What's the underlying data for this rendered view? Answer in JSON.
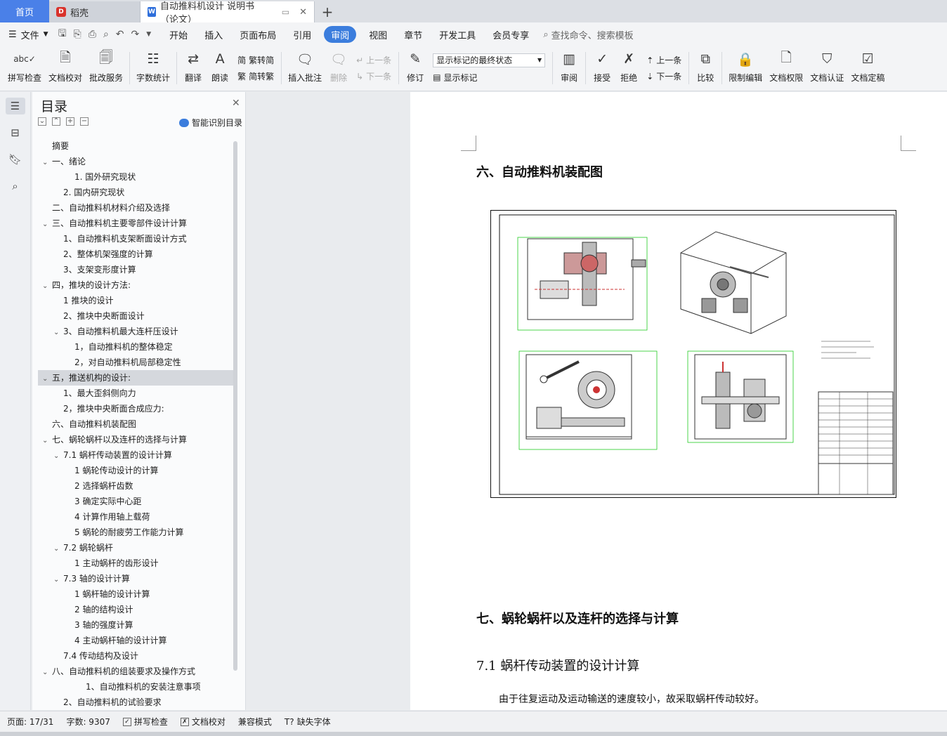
{
  "tabs": {
    "home": "首页",
    "daoke": "稻壳",
    "doc": "自动推料机设计 说明书（论文）"
  },
  "menu": {
    "file": "文件",
    "items": [
      "开始",
      "插入",
      "页面布局",
      "引用",
      "审阅",
      "视图",
      "章节",
      "开发工具",
      "会员专享"
    ],
    "active": "审阅",
    "search": "查找命令、搜索模板"
  },
  "ribbon": {
    "spell": "拼写检查",
    "proof": "文档校对",
    "batch": "批改服务",
    "wordcount": "字数统计",
    "translate": "翻译",
    "read": "朗读",
    "trad": "繁转简",
    "simp": "简转繁",
    "insert_comment": "插入批注",
    "delete": "删除",
    "prev": "上一条",
    "next": "下一条",
    "revise": "修订",
    "markup_state": "显示标记的最终状态",
    "show_markup": "显示标记",
    "review": "审阅",
    "accept": "接受",
    "reject": "拒绝",
    "prev2": "上一条",
    "next2": "下一条",
    "compare": "比较",
    "restrict": "限制编辑",
    "rights": "文档权限",
    "certify": "文档认证",
    "final": "文档定稿"
  },
  "toc": {
    "title": "目录",
    "smart": "智能识别目录",
    "items": [
      {
        "text": "摘要",
        "level": 0,
        "caret": ""
      },
      {
        "text": "一、绪论",
        "level": 0,
        "caret": "v"
      },
      {
        "text": "1. 国外研究现状",
        "level": 2,
        "caret": ""
      },
      {
        "text": "2. 国内研究现状",
        "level": 1,
        "caret": ""
      },
      {
        "text": "二、自动推料机材料介绍及选择",
        "level": 0,
        "caret": ""
      },
      {
        "text": "三、自动推料机主要零部件设计计算",
        "level": 0,
        "caret": "v"
      },
      {
        "text": "1、自动推料机支架断面设计方式",
        "level": 1,
        "caret": ""
      },
      {
        "text": "2、整体机架强度的计算",
        "level": 1,
        "caret": ""
      },
      {
        "text": "3、支架变形度计算",
        "level": 1,
        "caret": ""
      },
      {
        "text": "四，推块的设计方法:",
        "level": 0,
        "caret": "v"
      },
      {
        "text": "1 推块的设计",
        "level": 1,
        "caret": ""
      },
      {
        "text": "2、推块中央断面设计",
        "level": 1,
        "caret": ""
      },
      {
        "text": "3、自动推料机最大连杆压设计",
        "level": 1,
        "caret": "v"
      },
      {
        "text": "1，自动推料机的整体稳定",
        "level": 2,
        "caret": ""
      },
      {
        "text": "2，对自动推料机局部稳定性",
        "level": 2,
        "caret": ""
      },
      {
        "text": "五，推送机构的设计:",
        "level": 0,
        "caret": "v"
      },
      {
        "text": "1、最大歪斜侧向力",
        "level": 1,
        "caret": ""
      },
      {
        "text": "2，推块中央断面合成应力:",
        "level": 1,
        "caret": ""
      },
      {
        "text": "六、自动推料机装配图",
        "level": 0,
        "caret": ""
      },
      {
        "text": "七、蜗轮蜗杆以及连杆的选择与计算",
        "level": 0,
        "caret": "v"
      },
      {
        "text": "7.1  蜗杆传动装置的设计计算",
        "level": 1,
        "caret": "v"
      },
      {
        "text": "1 蜗轮传动设计的计算",
        "level": 2,
        "caret": ""
      },
      {
        "text": "2 选择蜗杆齿数",
        "level": 2,
        "caret": ""
      },
      {
        "text": "3 确定实际中心距",
        "level": 2,
        "caret": ""
      },
      {
        "text": "4 计算作用轴上载荷",
        "level": 2,
        "caret": ""
      },
      {
        "text": "5 蜗轮的耐疲劳工作能力计算",
        "level": 2,
        "caret": ""
      },
      {
        "text": "7.2   蜗轮蜗杆",
        "level": 1,
        "caret": "v"
      },
      {
        "text": "1 主动蜗杆的齿形设计",
        "level": 2,
        "caret": ""
      },
      {
        "text": "7.3    轴的设计计算",
        "level": 1,
        "caret": "v"
      },
      {
        "text": "1    蜗杆轴的设计计算",
        "level": 2,
        "caret": ""
      },
      {
        "text": "2 轴的结构设计",
        "level": 2,
        "caret": ""
      },
      {
        "text": "3    轴的强度计算",
        "level": 2,
        "caret": ""
      },
      {
        "text": "4 主动蜗杆轴的设计计算",
        "level": 2,
        "caret": ""
      },
      {
        "text": "7.4  传动结构及设计",
        "level": 1,
        "caret": ""
      },
      {
        "text": "八、自动推料机的组装要求及操作方式",
        "level": 0,
        "caret": "v"
      },
      {
        "text": "1、自动推料机的安装注意事项",
        "level": 3,
        "caret": ""
      },
      {
        "text": "2、自动推料机的试验要求",
        "level": 1,
        "caret": ""
      }
    ]
  },
  "document": {
    "heading6": "六、自动推料机装配图",
    "heading7": "七、蜗轮蜗杆以及连杆的选择与计算",
    "sub71": "7.1 蜗杆传动装置的设计计算",
    "para": "由于往复运动及运动输送的速度较小，故采取蜗杆传动较好。"
  },
  "statusbar": {
    "page": "页面: 17/31",
    "words": "字数: 9307",
    "spell": "拼写检查",
    "proof": "文档校对",
    "compat": "兼容模式",
    "missing_font": "缺失字体"
  }
}
